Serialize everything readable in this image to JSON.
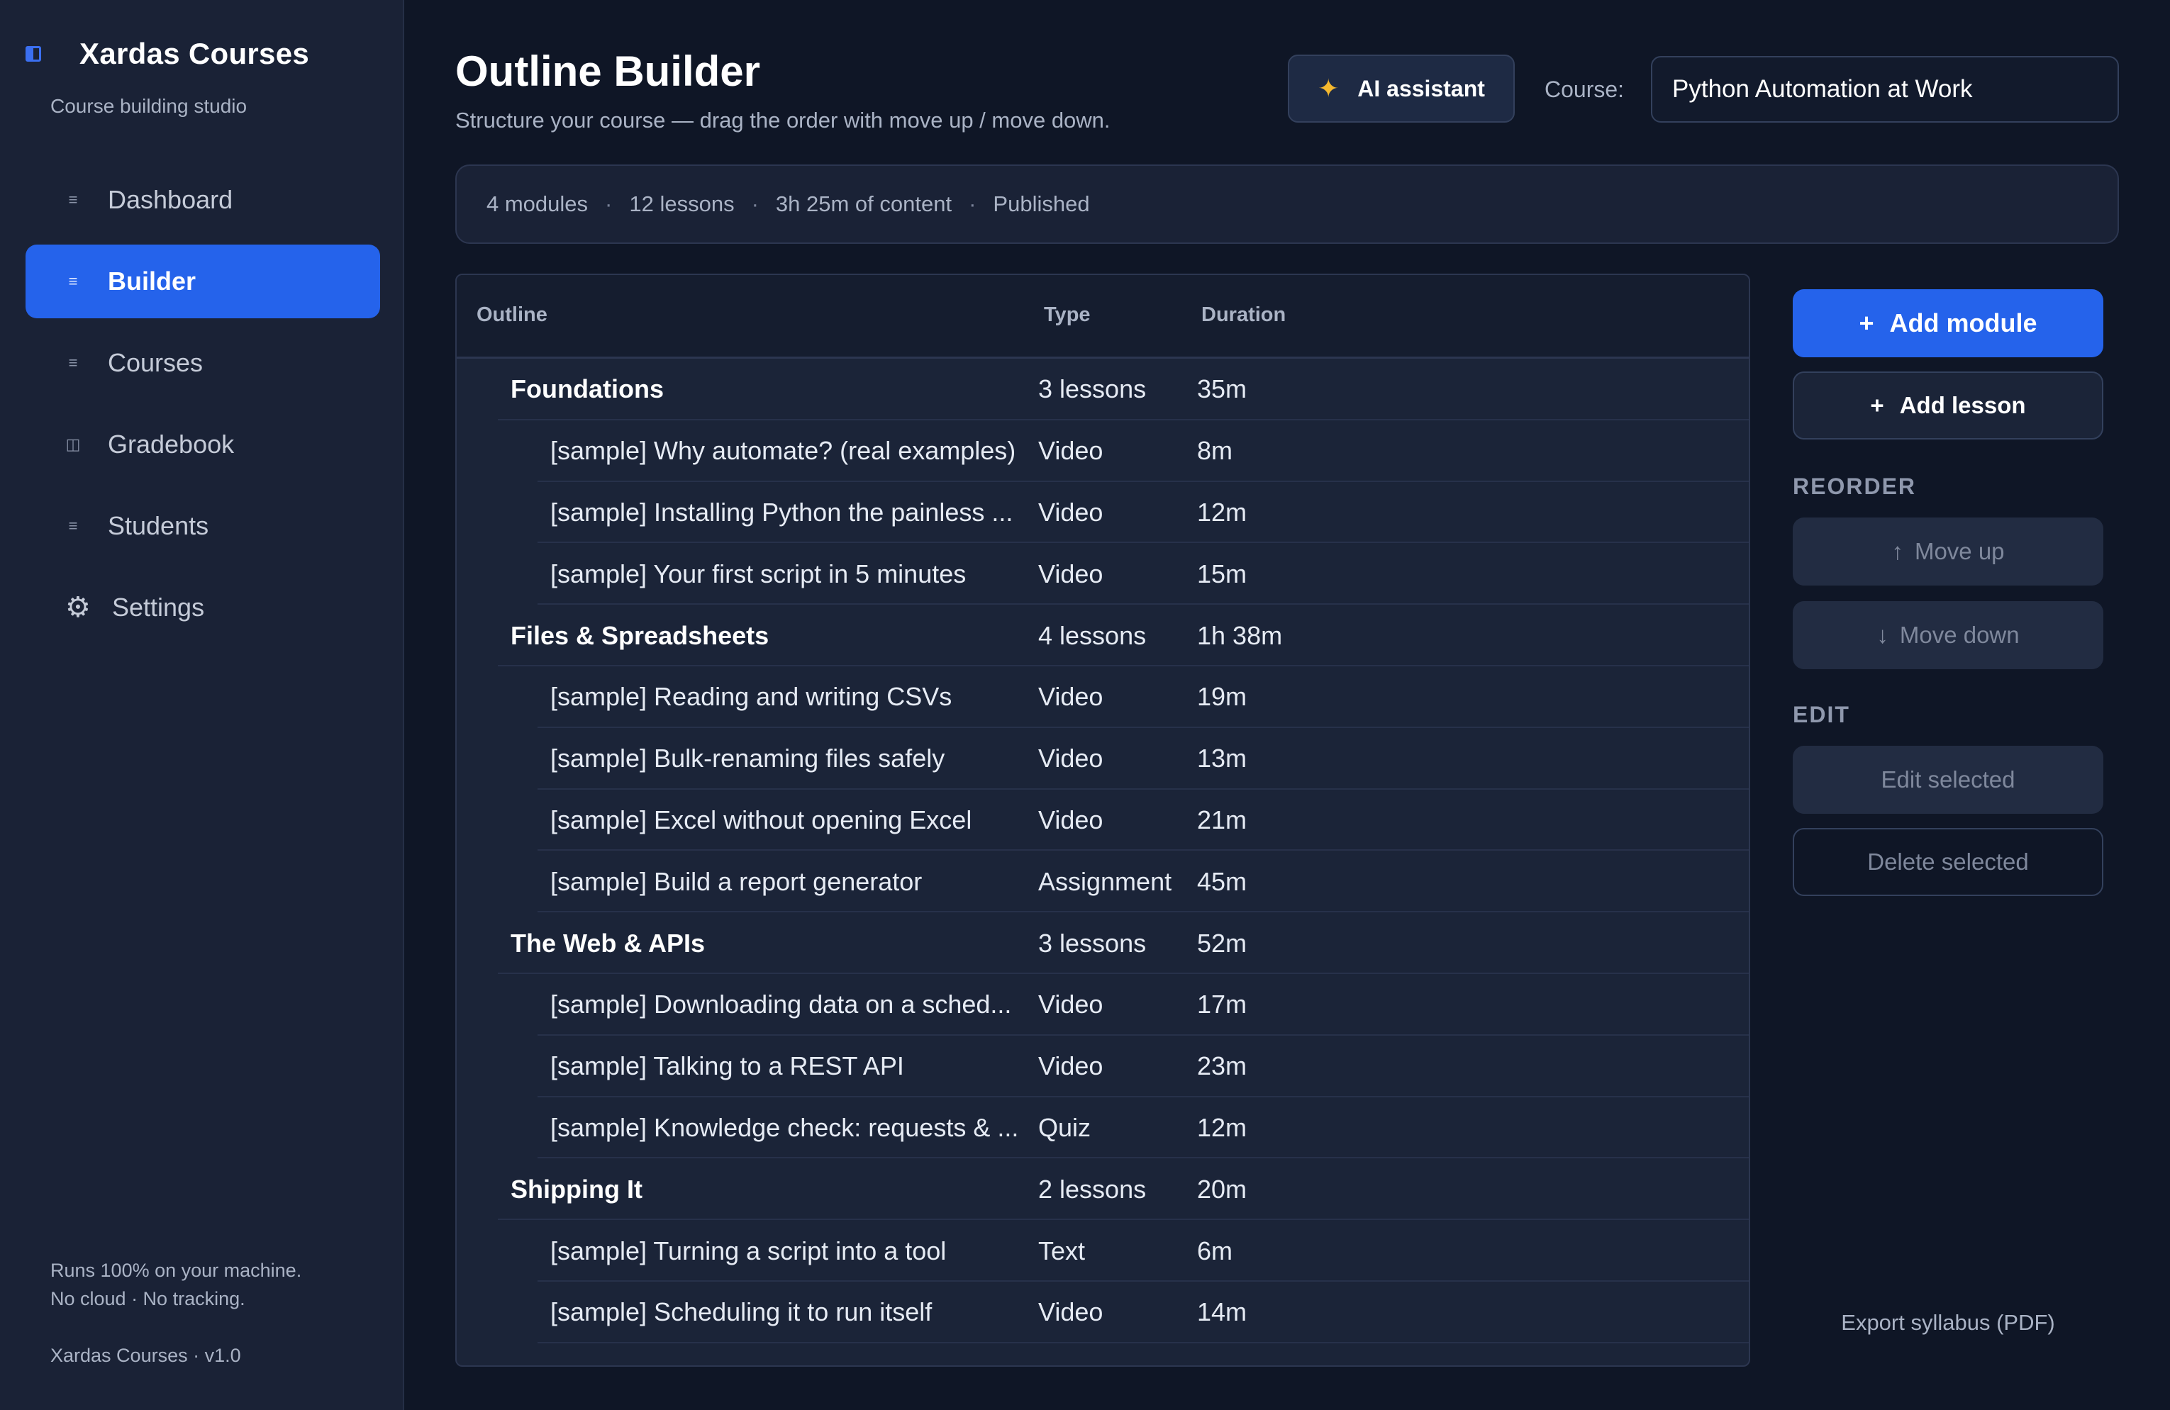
{
  "sidebar": {
    "brand_title": "Xardas Courses",
    "brand_subtitle": "Course building studio",
    "brand_icon": "sidebar-panel-icon",
    "items": [
      {
        "label": "Dashboard",
        "icon": "list-icon",
        "active": false
      },
      {
        "label": "Builder",
        "icon": "list-icon",
        "active": true
      },
      {
        "label": "Courses",
        "icon": "list-icon",
        "active": false
      },
      {
        "label": "Gradebook",
        "icon": "book-icon",
        "active": false
      },
      {
        "label": "Students",
        "icon": "list-icon",
        "active": false
      },
      {
        "label": "Settings",
        "icon": "gear-icon",
        "active": false
      }
    ],
    "footer_line1": "Runs 100% on your machine.",
    "footer_line2": "No cloud · No tracking.",
    "version": "Xardas Courses · v1.0"
  },
  "header": {
    "title": "Outline Builder",
    "subtitle": "Structure your course — drag the order with move up / move down.",
    "ai_button_label": "AI assistant",
    "course_label": "Course:",
    "course_value": "Python Automation at Work"
  },
  "stats": {
    "modules": "4 modules",
    "lessons": "12 lessons",
    "content": "3h 25m of content",
    "status": "Published",
    "separator": "·"
  },
  "table": {
    "headers": {
      "outline": "Outline",
      "type": "Type",
      "duration": "Duration"
    },
    "rows": [
      {
        "kind": "module",
        "title": "Foundations",
        "type": "3 lessons",
        "duration": "35m"
      },
      {
        "kind": "lesson",
        "title": "[sample] Why automate? (real examples)",
        "type": "Video",
        "duration": "8m"
      },
      {
        "kind": "lesson",
        "title": "[sample] Installing Python the painless ...",
        "type": "Video",
        "duration": "12m"
      },
      {
        "kind": "lesson",
        "title": "[sample] Your first script in 5 minutes",
        "type": "Video",
        "duration": "15m"
      },
      {
        "kind": "module",
        "title": "Files & Spreadsheets",
        "type": "4 lessons",
        "duration": "1h 38m"
      },
      {
        "kind": "lesson",
        "title": "[sample] Reading and writing CSVs",
        "type": "Video",
        "duration": "19m"
      },
      {
        "kind": "lesson",
        "title": "[sample] Bulk-renaming files safely",
        "type": "Video",
        "duration": "13m"
      },
      {
        "kind": "lesson",
        "title": "[sample] Excel without opening Excel",
        "type": "Video",
        "duration": "21m"
      },
      {
        "kind": "lesson",
        "title": "[sample] Build a report generator",
        "type": "Assignment",
        "duration": "45m"
      },
      {
        "kind": "module",
        "title": "The Web & APIs",
        "type": "3 lessons",
        "duration": "52m"
      },
      {
        "kind": "lesson",
        "title": "[sample] Downloading data on a sched...",
        "type": "Video",
        "duration": "17m"
      },
      {
        "kind": "lesson",
        "title": "[sample] Talking to a REST API",
        "type": "Video",
        "duration": "23m"
      },
      {
        "kind": "lesson",
        "title": "[sample] Knowledge check: requests & ...",
        "type": "Quiz",
        "duration": "12m"
      },
      {
        "kind": "module",
        "title": "Shipping It",
        "type": "2 lessons",
        "duration": "20m"
      },
      {
        "kind": "lesson",
        "title": "[sample] Turning a script into a tool",
        "type": "Text",
        "duration": "6m"
      },
      {
        "kind": "lesson",
        "title": "[sample] Scheduling it to run itself",
        "type": "Video",
        "duration": "14m"
      }
    ]
  },
  "actions": {
    "add_module": "Add module",
    "add_lesson": "Add lesson",
    "plus": "+",
    "reorder_label": "REORDER",
    "move_up": "Move up",
    "move_down": "Move down",
    "up_arrow": "↑",
    "down_arrow": "↓",
    "edit_label": "EDIT",
    "edit_selected": "Edit selected",
    "delete_selected": "Delete selected",
    "export": "Export syllabus (PDF)"
  },
  "colors": {
    "accent": "#2563eb",
    "background": "#0f1626",
    "sidebar": "#1a2236",
    "panel": "#1b2438"
  }
}
